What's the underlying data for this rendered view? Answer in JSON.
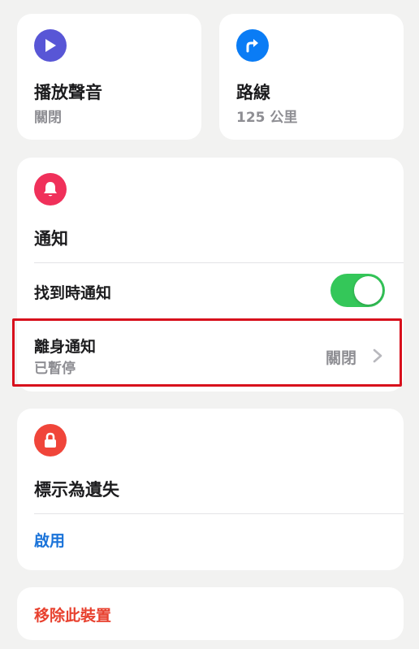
{
  "colors": {
    "background": "#f2f2f1",
    "card": "#ffffff",
    "purple_icon": "#5856d6",
    "blue_icon": "#0a7cf5",
    "pink_icon": "#f0305a",
    "red_icon": "#f0453a",
    "toggle_on": "#34c759",
    "link_blue": "#1a73d9",
    "destructive_red": "#e8412f",
    "highlight_red": "#d8101c"
  },
  "tiles": {
    "play_sound": {
      "title": "播放聲音",
      "status": "關閉",
      "icon": "play-icon"
    },
    "route": {
      "title": "路線",
      "distance": "125 公里",
      "icon": "turn-right-arrow-icon"
    }
  },
  "notifications": {
    "icon": "bell-icon",
    "title": "通知",
    "notify_when_found": {
      "label": "找到時通知",
      "enabled": true
    },
    "notify_when_left_behind": {
      "label": "離身通知",
      "sub": "已暫停",
      "value": "關閉"
    }
  },
  "lost_mode": {
    "icon": "lock-icon",
    "title": "標示為遺失",
    "action": "啟用"
  },
  "remove_device": {
    "label": "移除此裝置"
  }
}
